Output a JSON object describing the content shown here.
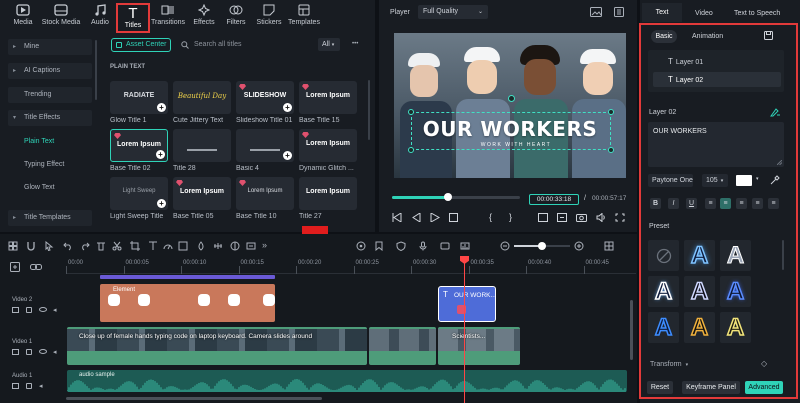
{
  "media_toolbar": {
    "tools": [
      {
        "label": "Media",
        "icon": "media-icon"
      },
      {
        "label": "Stock Media",
        "icon": "stock-media-icon"
      },
      {
        "label": "Audio",
        "icon": "audio-icon"
      },
      {
        "label": "Titles",
        "icon": "titles-icon",
        "active": true
      },
      {
        "label": "Transitions",
        "icon": "transitions-icon"
      },
      {
        "label": "Effects",
        "icon": "effects-icon"
      },
      {
        "label": "Filters",
        "icon": "filters-icon"
      },
      {
        "label": "Stickers",
        "icon": "stickers-icon"
      },
      {
        "label": "Templates",
        "icon": "templates-icon"
      }
    ]
  },
  "sidebar": {
    "items": [
      {
        "label": "Mine",
        "caret": "▸"
      },
      {
        "label": "AI Captions",
        "caret": "▸"
      },
      {
        "label": "Trending",
        "caret": ""
      },
      {
        "label": "Title Effects",
        "caret": "▾"
      },
      {
        "label": "Plain Text",
        "caret": ""
      },
      {
        "label": "Typing Effect",
        "caret": ""
      },
      {
        "label": "Glow Text",
        "caret": ""
      },
      {
        "label": "Title Templates",
        "caret": "▸"
      }
    ]
  },
  "asset_bar": {
    "asset_center": "Asset Center",
    "search_placeholder": "Search all titles",
    "filter": "All",
    "more": "•••"
  },
  "section_title": "PLAIN TEXT",
  "titles": [
    {
      "thumb": "RADIATE",
      "caption": "Glow Title 1",
      "gem": false,
      "plus": true,
      "color": "#d8dbe0"
    },
    {
      "thumb": "Beautiful Day",
      "caption": "Cute Jittery Text",
      "gem": false,
      "plus": false,
      "color": "#f2d44a"
    },
    {
      "thumb": "SLIDESHOW",
      "caption": "Slideshow Title 01",
      "gem": true,
      "plus": true,
      "color": "#ffffff"
    },
    {
      "thumb": "Lorem Ipsum",
      "caption": "Base Title 15",
      "gem": true,
      "plus": false,
      "color": "#ffffff"
    },
    {
      "thumb": "Lorem Ipsum",
      "caption": "Base Title 02",
      "gem": true,
      "plus": true,
      "color": "#ffffff"
    },
    {
      "thumb": "",
      "caption": "Title 28",
      "gem": false,
      "plus": false,
      "color": "#ffffff"
    },
    {
      "thumb": "",
      "caption": "Basic 4",
      "gem": false,
      "plus": true,
      "color": "#ffffff"
    },
    {
      "thumb": "Lorem Ipsum",
      "caption": "Dynamic Glitch ...",
      "gem": true,
      "plus": false,
      "color": "#ffffff"
    },
    {
      "thumb": "Light Sweep",
      "caption": "Light Sweep Title",
      "gem": false,
      "plus": true,
      "color": "#9aa0a8"
    },
    {
      "thumb": "Lorem Ipsum",
      "caption": "Base Title 05",
      "gem": true,
      "plus": false,
      "color": "#ffffff"
    },
    {
      "thumb": "Lorem Ipsum",
      "caption": "Base Title 10",
      "gem": true,
      "plus": false,
      "color": "#d8dbe0"
    },
    {
      "thumb": "Lorem Ipsum",
      "caption": "Title 27",
      "gem": false,
      "plus": false,
      "color": "#ffffff"
    }
  ],
  "player": {
    "label": "Player",
    "quality": "Full Quality",
    "overlay_title": "OUR WORKERS",
    "overlay_subtitle": "WORK WITH HEART",
    "current_time": "00:00:33:18",
    "separator": "/",
    "total_time": "00:00:57:17",
    "progress": 0.44
  },
  "right_panel": {
    "tabs": [
      "Text",
      "Video",
      "Text to Speech"
    ],
    "subtabs": [
      "Basic",
      "Animation"
    ],
    "layers": [
      "Layer 01",
      "Layer 02"
    ],
    "layer_heading": "Layer 02",
    "text_value": "OUR WORKERS",
    "font": "Paytone One",
    "font_size": "105",
    "text_color": "#ffffff",
    "format_buttons": [
      "B",
      "I",
      "U"
    ],
    "preset_label": "Preset",
    "transform_label": "Transform",
    "buttons": {
      "reset": "Reset",
      "keyframe": "Keyframe Panel",
      "advanced": "Advanced"
    },
    "accent": "#2fd3b8"
  },
  "timeline": {
    "ticks": [
      "00:00",
      "00:00:05",
      "00:00:10",
      "00:00:15",
      "00:00:20",
      "00:00:25",
      "00:00:30",
      "00:00:35",
      "00:00:40",
      "00:00:45"
    ],
    "tracks": [
      {
        "name": "Video 2"
      },
      {
        "name": "Video 1"
      },
      {
        "name": "Audio 1"
      }
    ],
    "clips": {
      "sticker": "Element",
      "title": "OUR WORK...",
      "video_a": "Close up of female hands typing code on laptop keyboard. Camera slides around",
      "video_b": "Scientists...",
      "audio": "audio sample"
    }
  }
}
